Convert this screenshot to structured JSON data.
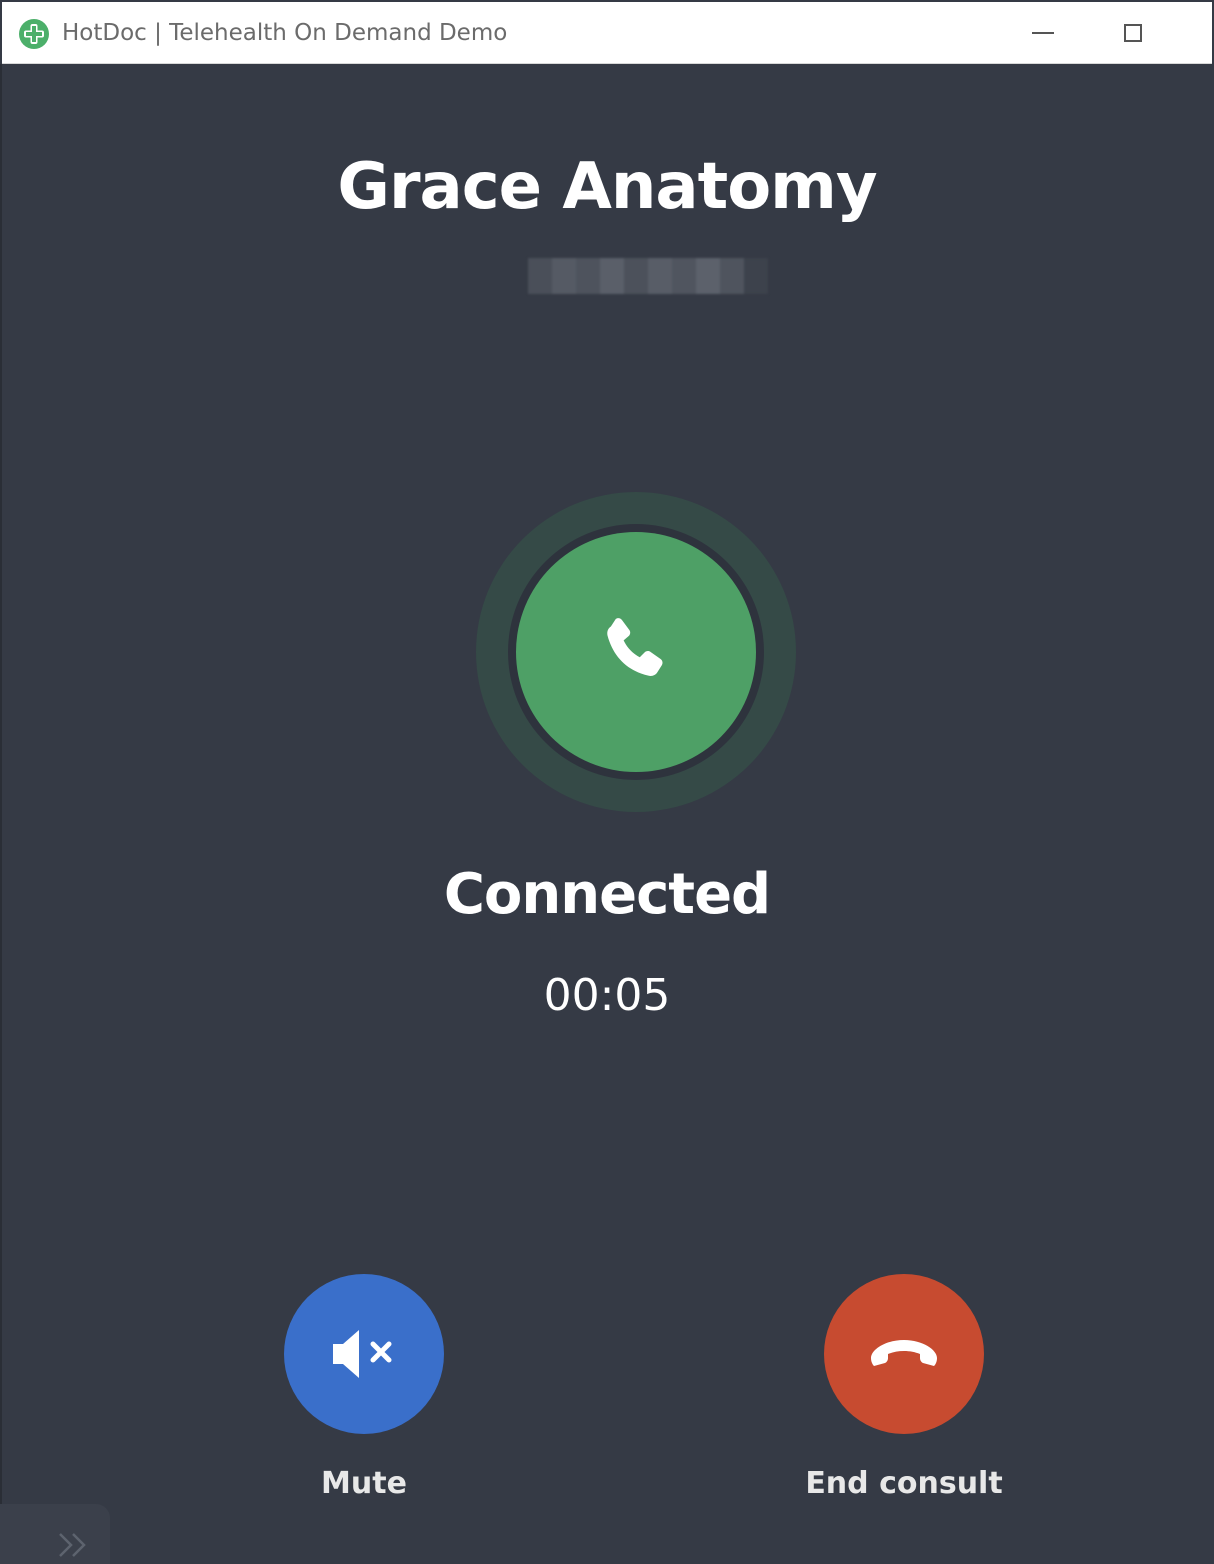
{
  "window": {
    "title": "HotDoc | Telehealth On Demand Demo",
    "logo_icon": "hotdoc-cross-logo-icon",
    "controls": {
      "minimize_icon": "minimize-icon",
      "maximize_icon": "maximize-icon"
    }
  },
  "call": {
    "caller_name": "Grace Anatomy",
    "status": "Connected",
    "timer": "00:05",
    "status_icon": "phone-icon"
  },
  "actions": {
    "mute": {
      "label": "Mute",
      "icon": "speaker-muted-icon"
    },
    "end": {
      "label": "End consult",
      "icon": "hang-up-icon"
    }
  },
  "colors": {
    "background": "#353a45",
    "connected_green": "#4ea066",
    "mute_blue": "#3a6fca",
    "end_red": "#c74b30",
    "logo_green": "#4caf6a"
  }
}
